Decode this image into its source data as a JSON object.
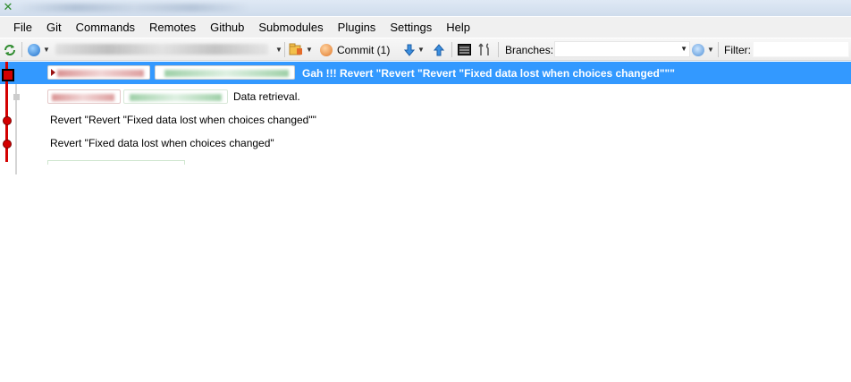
{
  "menu": [
    "File",
    "Git",
    "Commands",
    "Remotes",
    "Github",
    "Submodules",
    "Plugins",
    "Settings",
    "Help"
  ],
  "toolbar": {
    "commit_label": "Commit (1)",
    "branches_label": "Branches:",
    "filter_label": "Filter:"
  },
  "commits": [
    {
      "message": "Gah !!! Revert \"Revert \"Revert \"Fixed data lost when choices changed\"\"\""
    },
    {
      "message": "Data retrieval."
    },
    {
      "message": "Revert \"Revert \"Fixed data lost when choices changed\"\""
    },
    {
      "message": "Revert \"Fixed data lost when choices changed\""
    }
  ],
  "colors": {
    "selection": "#3399ff",
    "graph_branch": "#d40000"
  }
}
